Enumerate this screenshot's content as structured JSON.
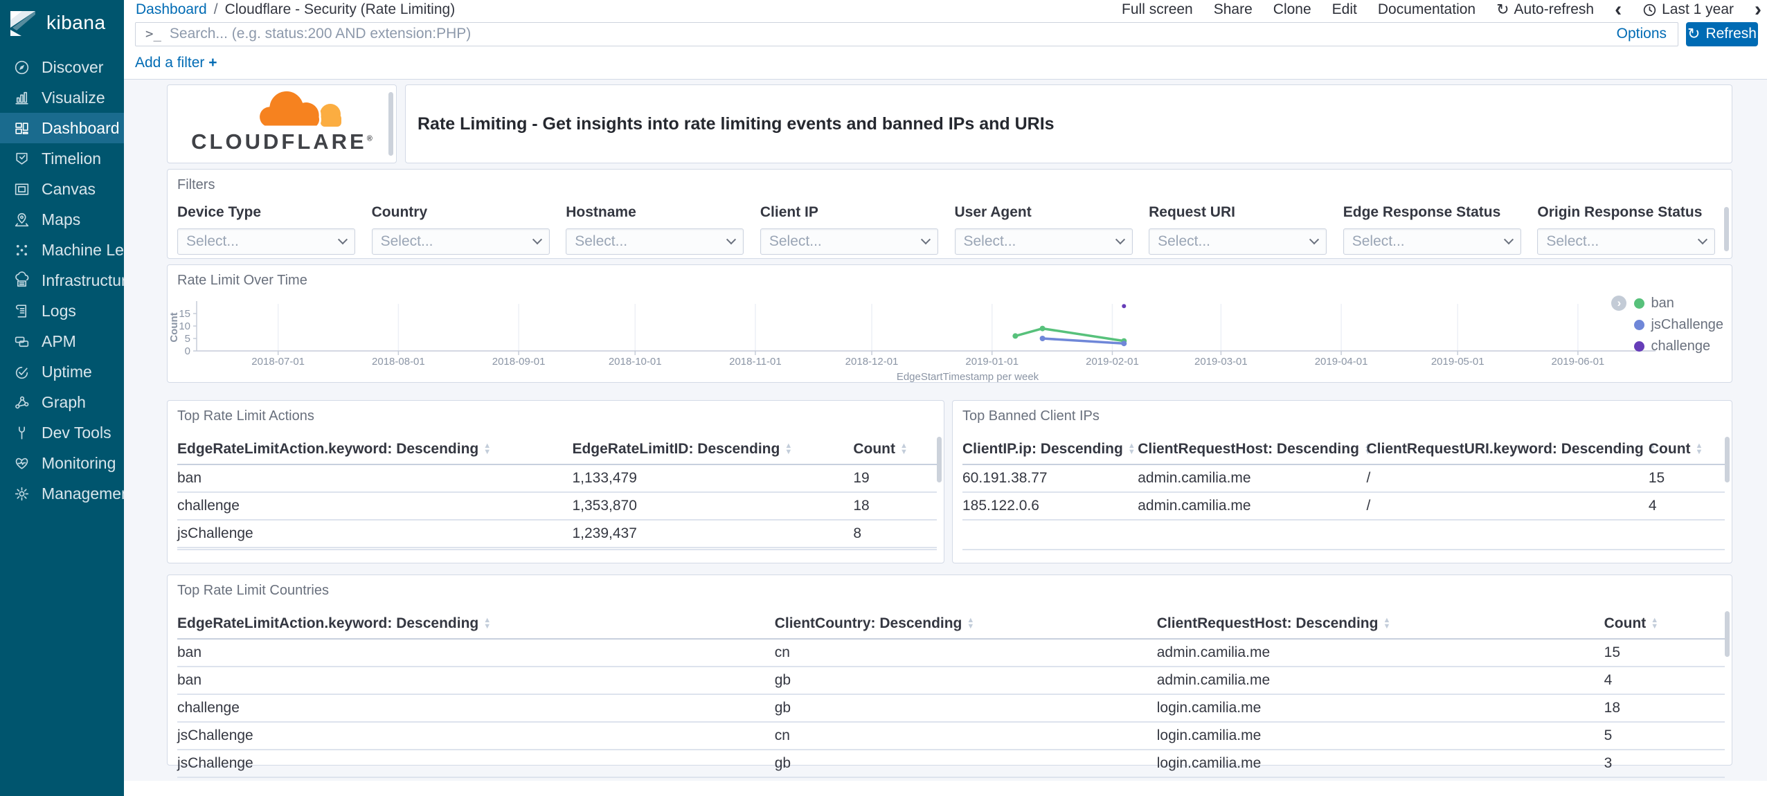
{
  "colors": {
    "accent_blue": "#006bb4",
    "sidebar_bg": "#00556e",
    "sidebar_active_bg": "#1a6b8e",
    "panel_border": "#d3dae6",
    "page_bg": "#f4f6fa",
    "cloudflare_orange": "#f6821f",
    "cloudflare_light_orange": "#fbad41",
    "series_ban": "#57c17b",
    "series_jschallenge": "#6f87d8",
    "series_challenge": "#663db8"
  },
  "icons": {
    "terminal_prompt": ">_",
    "refresh": "↻",
    "chevron_left": "‹",
    "chevron_right": "›",
    "plus": "+"
  },
  "sidebar": {
    "logo_text": "kibana",
    "items": [
      {
        "label": "Discover",
        "icon": "compass-icon",
        "active": false
      },
      {
        "label": "Visualize",
        "icon": "bar-chart-icon",
        "active": false
      },
      {
        "label": "Dashboard",
        "icon": "dashboard-grid-icon",
        "active": true
      },
      {
        "label": "Timelion",
        "icon": "timelion-icon",
        "active": false
      },
      {
        "label": "Canvas",
        "icon": "canvas-frame-icon",
        "active": false
      },
      {
        "label": "Maps",
        "icon": "map-pin-icon",
        "active": false
      },
      {
        "label": "Machine Le...",
        "icon": "machine-learning-icon",
        "active": false
      },
      {
        "label": "Infrastructure",
        "icon": "infrastructure-icon",
        "active": false
      },
      {
        "label": "Logs",
        "icon": "logs-icon",
        "active": false
      },
      {
        "label": "APM",
        "icon": "apm-icon",
        "active": false
      },
      {
        "label": "Uptime",
        "icon": "uptime-icon",
        "active": false
      },
      {
        "label": "Graph",
        "icon": "graph-icon",
        "active": false
      },
      {
        "label": "Dev Tools",
        "icon": "wrench-icon",
        "active": false
      },
      {
        "label": "Monitoring",
        "icon": "monitoring-icon",
        "active": false
      },
      {
        "label": "Management",
        "icon": "gear-icon",
        "active": false
      }
    ]
  },
  "topbar": {
    "breadcrumb": {
      "link": "Dashboard",
      "separator": "/",
      "current": "Cloudflare - Security (Rate Limiting)"
    },
    "actions": [
      "Full screen",
      "Share",
      "Clone",
      "Edit",
      "Documentation"
    ],
    "auto_refresh": "Auto-refresh",
    "time_range": "Last 1 year"
  },
  "querybar": {
    "placeholder": "Search... (e.g. status:200 AND extension:PHP)",
    "value": "",
    "options_label": "Options",
    "refresh_label": "Refresh"
  },
  "filter_bar": {
    "add_filter_label": "Add a filter"
  },
  "branding": {
    "logo_text": "CLOUDFLARE",
    "registered": "®",
    "title": "Rate Limiting - Get insights into rate limiting events and banned IPs and URIs"
  },
  "filters_panel": {
    "title": "Filters",
    "select_placeholder": "Select...",
    "fields": [
      "Device Type",
      "Country",
      "Hostname",
      "Client IP",
      "User Agent",
      "Request URI",
      "Edge Response Status",
      "Origin Response Status"
    ]
  },
  "chart_data": {
    "type": "line",
    "title": "Rate Limit Over Time",
    "xlabel": "EdgeStartTimestamp per week",
    "ylabel": "Count",
    "x_domain": [
      "2018-06-10",
      "2019-06-21"
    ],
    "x_ticks": [
      "2018-07-01",
      "2018-08-01",
      "2018-09-01",
      "2018-10-01",
      "2018-11-01",
      "2018-12-01",
      "2019-01-01",
      "2019-02-01",
      "2019-03-01",
      "2019-04-01",
      "2019-05-01",
      "2019-06-01"
    ],
    "ylim": [
      0,
      18.3
    ],
    "y_ticks": [
      0,
      5,
      10,
      15
    ],
    "grid": "vertical-faint",
    "legend_position": "right",
    "series": [
      {
        "name": "ban",
        "color": "#57c17b",
        "points": [
          [
            "2019-01-07",
            6
          ],
          [
            "2019-01-14",
            9
          ],
          [
            "2019-02-04",
            4
          ]
        ]
      },
      {
        "name": "jsChallenge",
        "color": "#6f87d8",
        "points": [
          [
            "2019-01-14",
            5
          ],
          [
            "2019-02-04",
            3
          ]
        ]
      },
      {
        "name": "challenge",
        "color": "#663db8",
        "points": [
          [
            "2019-02-04",
            18
          ]
        ]
      }
    ]
  },
  "tables": {
    "actions": {
      "title": "Top Rate Limit Actions",
      "columns": [
        "EdgeRateLimitAction.keyword: Descending",
        "EdgeRateLimitID: Descending",
        "Count"
      ],
      "rows": [
        [
          "ban",
          "1,133,479",
          "19"
        ],
        [
          "challenge",
          "1,353,870",
          "18"
        ],
        [
          "jsChallenge",
          "1,239,437",
          "8"
        ]
      ]
    },
    "banned_ips": {
      "title": "Top Banned Client IPs",
      "columns": [
        "ClientIP.ip: Descending",
        "ClientRequestHost: Descending",
        "ClientRequestURI.keyword: Descending",
        "Count"
      ],
      "rows": [
        [
          "60.191.38.77",
          "admin.camilia.me",
          "/",
          "15"
        ],
        [
          "185.122.0.6",
          "admin.camilia.me",
          "/",
          "4"
        ]
      ]
    },
    "countries": {
      "title": "Top Rate Limit Countries",
      "columns": [
        "EdgeRateLimitAction.keyword: Descending",
        "ClientCountry: Descending",
        "ClientRequestHost: Descending",
        "Count"
      ],
      "rows": [
        [
          "ban",
          "cn",
          "admin.camilia.me",
          "15"
        ],
        [
          "ban",
          "gb",
          "admin.camilia.me",
          "4"
        ],
        [
          "challenge",
          "gb",
          "login.camilia.me",
          "18"
        ],
        [
          "jsChallenge",
          "cn",
          "login.camilia.me",
          "5"
        ],
        [
          "jsChallenge",
          "gb",
          "login.camilia.me",
          "3"
        ]
      ]
    }
  }
}
